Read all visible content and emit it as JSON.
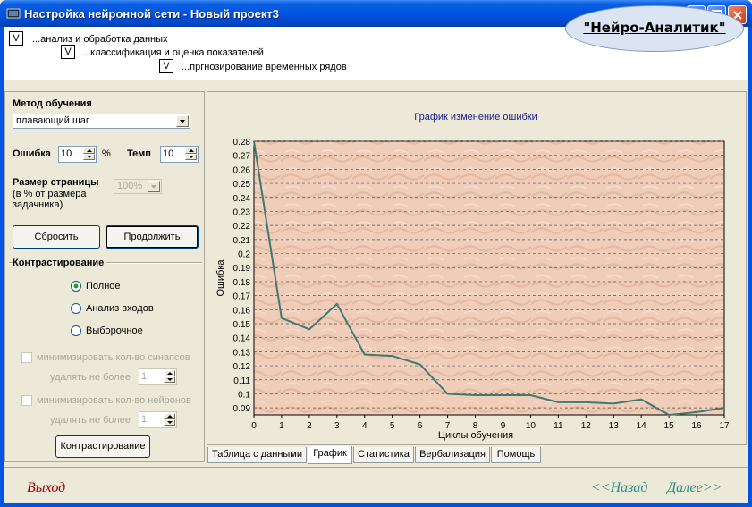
{
  "window": {
    "title": "Настройка нейронной сети - Новый проект3"
  },
  "header": {
    "checks": [
      {
        "mark": "V",
        "label": "...анализ и обработка данных"
      },
      {
        "mark": "V",
        "label": "...классификация и оценка показателей"
      },
      {
        "mark": "V",
        "label": "...пргнозирование временных рядов"
      }
    ],
    "brand": "\"Нейро-Аналитик\""
  },
  "left": {
    "method_label": "Метод обучения",
    "method_value": "плавающий шаг",
    "error_label": "Ошибка",
    "error_value": "10",
    "error_unit": "%",
    "tempo_label": "Темп",
    "tempo_value": "10",
    "page_size_label": "Размер страницы",
    "page_size_note1": "(в % от размера",
    "page_size_note2": "задачника)",
    "page_size_value": "100%",
    "reset_button": "Сбросить",
    "continue_button": "Продолжить",
    "contrast_title": "Контрастирование",
    "radios": [
      {
        "label": "Полное",
        "checked": true
      },
      {
        "label": "Анализ входов",
        "checked": false
      },
      {
        "label": "Выборочное",
        "checked": false
      }
    ],
    "min_synapses": "минимизировать кол-во синапсов",
    "delete_max_1": "удалять не более",
    "delete_value_1": "1",
    "min_neurons": "минимизировать кол-во нейронов",
    "delete_max_2": "удалять не более",
    "delete_value_2": "1",
    "contrast_button": "Контрастирование"
  },
  "tabs": [
    {
      "label": "Таблица с данными",
      "active": false
    },
    {
      "label": "График",
      "active": true
    },
    {
      "label": "Статистика",
      "active": false
    },
    {
      "label": "Вербализация",
      "active": false
    },
    {
      "label": "Помощь",
      "active": false
    }
  ],
  "footer": {
    "exit": "Выход",
    "back": "<<Назад",
    "next": "Далее>>"
  },
  "colors": {
    "line": "#3f7a72",
    "plot_bg": "#f0cdb8",
    "title": "#1a1a8c",
    "exit": "#a00000",
    "nav": "#2e8b87"
  },
  "chart_data": {
    "type": "line",
    "title": "График изменение ошибки",
    "xlabel": "Циклы обучения",
    "ylabel": "Ошибка",
    "x": [
      0,
      1,
      2,
      3,
      4,
      5,
      6,
      7,
      8,
      9,
      10,
      11,
      12,
      13,
      14,
      15,
      16,
      17
    ],
    "y": [
      0.28,
      0.154,
      0.146,
      0.164,
      0.128,
      0.127,
      0.121,
      0.1,
      0.099,
      0.099,
      0.099,
      0.094,
      0.094,
      0.093,
      0.096,
      0.085,
      0.087,
      0.09
    ],
    "xlim": [
      0,
      17
    ],
    "ylim": [
      0.085,
      0.28
    ],
    "yticks": [
      0.09,
      0.1,
      0.11,
      0.12,
      0.13,
      0.14,
      0.15,
      0.16,
      0.17,
      0.18,
      0.19,
      0.2,
      0.21,
      0.22,
      0.23,
      0.24,
      0.25,
      0.26,
      0.27,
      0.28
    ],
    "grid": true
  }
}
